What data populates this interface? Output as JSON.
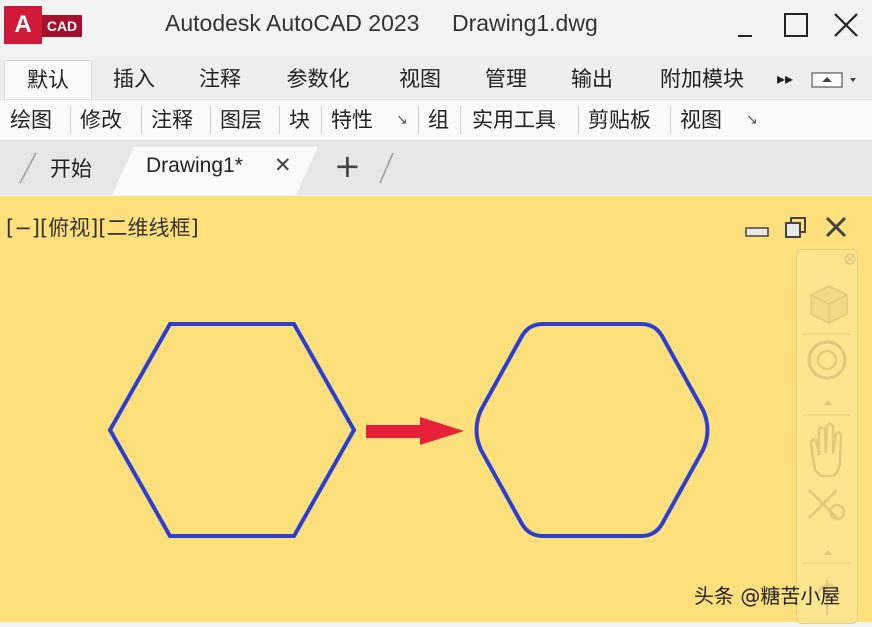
{
  "logo": {
    "letter": "A",
    "text": "CAD"
  },
  "title": {
    "app": "Autodesk AutoCAD 2023",
    "document": "Drawing1.dwg"
  },
  "ribbon_tabs": [
    "默认",
    "插入",
    "注释",
    "参数化",
    "视图",
    "管理",
    "输出",
    "附加模块"
  ],
  "ribbon_tabs_more": "▸▸",
  "ribbon_panels": [
    "绘图",
    "修改",
    "注释",
    "图层",
    "块",
    "特性",
    "组",
    "实用工具",
    "剪贴板",
    "视图"
  ],
  "panel_expand_glyph": "↘",
  "file_tabs": {
    "start": "开始",
    "drawing": "Drawing1*",
    "close_glyph": "✕",
    "add_glyph": "+"
  },
  "viewport": {
    "label": "[−][俯视][二维线框]",
    "background": "#fde07c"
  },
  "drawing": {
    "shape_color": "#2c3fd0",
    "arrow_color": "#e8213a"
  },
  "watermark": "头条 @糖苦小屋"
}
